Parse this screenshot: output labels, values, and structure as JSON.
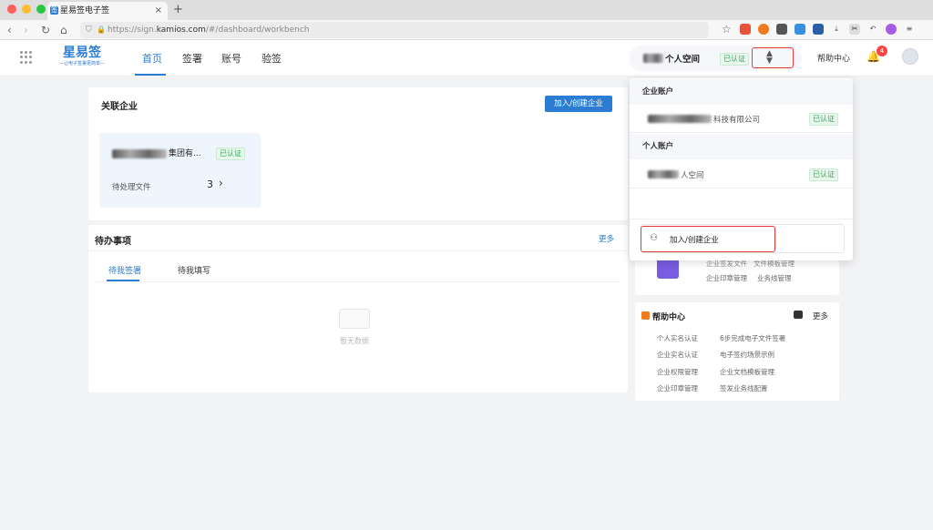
{
  "browser": {
    "tab_title": "星易签电子签",
    "tab_favicon": "签",
    "new_tab": "+",
    "url_prefix": "https://sign.",
    "url_host": "kamios.com",
    "url_path": "/#/dashboard/workbench"
  },
  "header": {
    "logo_title": "星易签",
    "logo_slogan": "—让电子签署更简单—",
    "nav": [
      "首页",
      "签署",
      "账号",
      "验签"
    ],
    "space_name": "个人空间",
    "space_badge": "已认证",
    "help_label": "帮助中心",
    "notifications": "4"
  },
  "company_card": {
    "title": "关联企业",
    "join_button": "加入/创建企业",
    "company_name_suffix": "集团有...",
    "company_badge": "已认证",
    "pending_label": "待处理文件",
    "pending_count": "3"
  },
  "todo_card": {
    "title": "待办事项",
    "more": "更多",
    "tabs": [
      "待我签署",
      "待我填写"
    ],
    "empty_text": "暂无数据"
  },
  "features_card": {
    "items": [
      "企业签发文件",
      "文件模板管理",
      "企业印章管理",
      "业务线管理"
    ]
  },
  "help_card": {
    "title": "帮助中心",
    "more": "更多",
    "items": [
      "个人实名认证",
      "6步完成电子文件签署",
      "企业实名认证",
      "电子签约场景示例",
      "企业权限管理",
      "企业文档模板管理",
      "企业印章管理",
      "签发业务线配置"
    ]
  },
  "dropdown": {
    "enterprise_section": "企业账户",
    "enterprise_name_suffix": "科技有限公司",
    "enterprise_badge": "已认证",
    "personal_section": "个人账户",
    "personal_name_suffix": "人空间",
    "personal_badge": "已认证",
    "join_button": "加入/创建企业"
  },
  "colors": {
    "primary": "#2b7cd3",
    "success": "#3aa55c",
    "highlight": "#e53935"
  }
}
